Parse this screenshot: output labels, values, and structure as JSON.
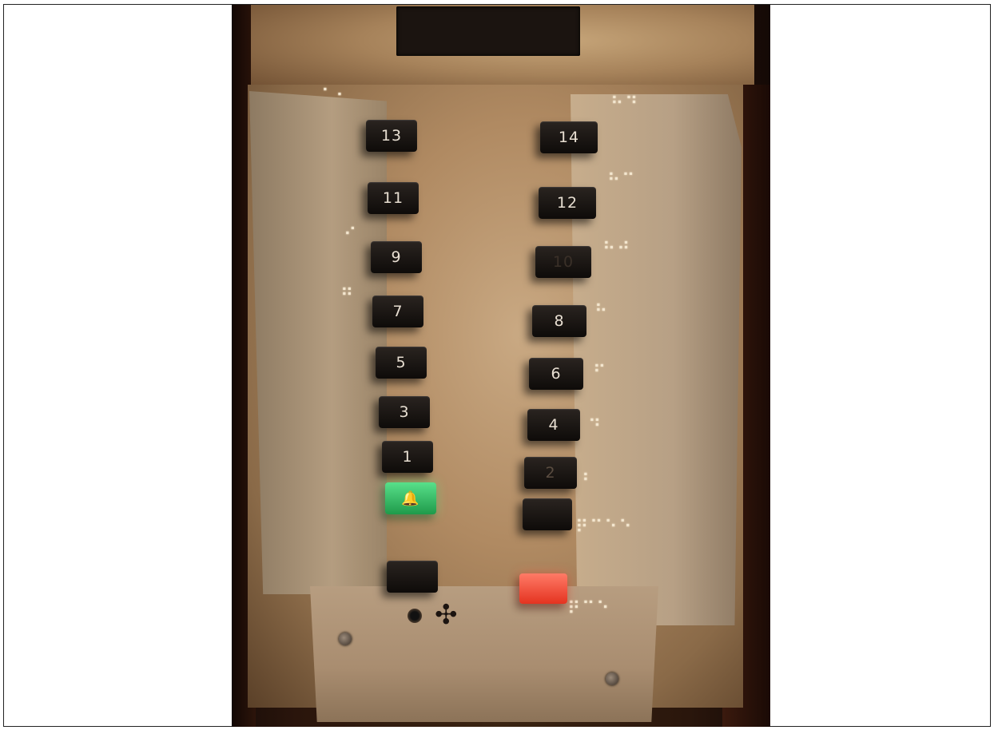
{
  "photo": {
    "subject": "elevator button panel",
    "left_buttons": [
      {
        "label": "13"
      },
      {
        "label": "11"
      },
      {
        "label": "9"
      },
      {
        "label": "7"
      },
      {
        "label": "5"
      },
      {
        "label": "3"
      },
      {
        "label": "1"
      }
    ],
    "right_buttons": [
      {
        "label": "14"
      },
      {
        "label": "12"
      },
      {
        "label": "10"
      },
      {
        "label": "8"
      },
      {
        "label": "6"
      },
      {
        "label": "4"
      },
      {
        "label": "2"
      }
    ],
    "colors": {
      "green_light": "#33c46a",
      "red_light": "#f04a34"
    },
    "icons": {
      "bell": "bell-icon",
      "fan": "fan-icon"
    }
  }
}
